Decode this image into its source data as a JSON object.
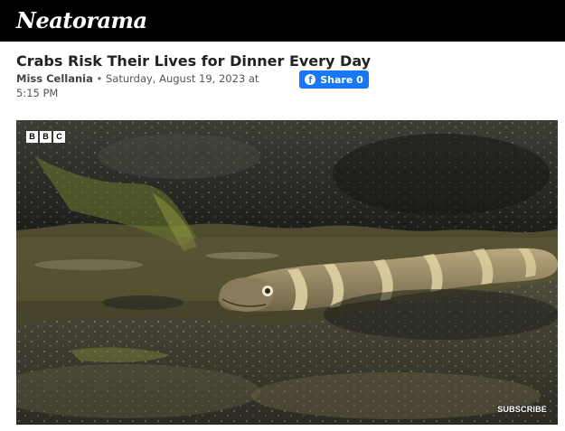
{
  "site": {
    "logo_text": "Neatorama"
  },
  "article": {
    "title": "Crabs Risk Their Lives for Dinner Every Day",
    "author": "Miss Cellania",
    "separator": "•",
    "date": "Saturday, August 19, 2023 at 5:15 PM"
  },
  "share": {
    "label": "Share 0",
    "icon": "facebook-icon",
    "color": "#1877f2"
  },
  "video": {
    "broadcaster_letters": [
      "B",
      "B",
      "C"
    ],
    "subscribe_label": "SUBSCRIBE"
  }
}
